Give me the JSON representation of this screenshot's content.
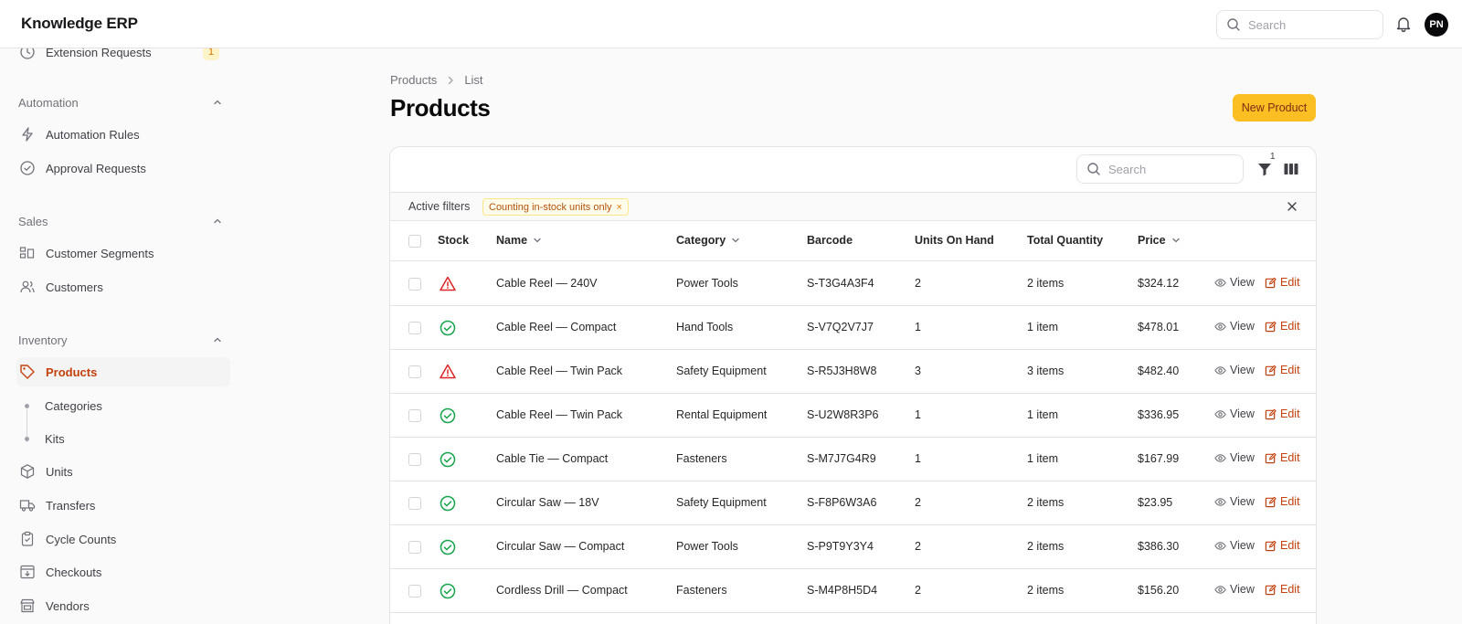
{
  "app": {
    "title": "Knowledge ERP",
    "user_initials": "PN"
  },
  "topbar": {
    "search_placeholder": "Search"
  },
  "sidebar": {
    "extension_requests": {
      "label": "Extension Requests",
      "badge": "1"
    },
    "groups": {
      "automation": {
        "label": "Automation",
        "items": [
          "Automation Rules",
          "Approval Requests"
        ]
      },
      "sales": {
        "label": "Sales",
        "items": [
          "Customer Segments",
          "Customers"
        ]
      },
      "inventory": {
        "label": "Inventory",
        "items": [
          "Products",
          "Categories",
          "Kits",
          "Units",
          "Transfers",
          "Cycle Counts",
          "Checkouts",
          "Vendors"
        ]
      }
    },
    "active_item": "Products"
  },
  "breadcrumb": [
    "Products",
    "List"
  ],
  "page": {
    "title": "Products",
    "new_button": "New Product"
  },
  "table_toolbar": {
    "search_placeholder": "Search",
    "filter_count": "1"
  },
  "filters": {
    "label": "Active filters",
    "chips": [
      "Counting in-stock units only"
    ]
  },
  "table": {
    "columns": [
      "Stock",
      "Name",
      "Category",
      "Barcode",
      "Units On Hand",
      "Total Quantity",
      "Price"
    ],
    "view_label": "View",
    "edit_label": "Edit",
    "rows": [
      {
        "stock": "warning",
        "name": "Cable Reel — 240V",
        "category": "Power Tools",
        "barcode": "S-T3G4A3F4",
        "units": "2",
        "total": "2 items",
        "price": "$324.12"
      },
      {
        "stock": "ok",
        "name": "Cable Reel — Compact",
        "category": "Hand Tools",
        "barcode": "S-V7Q2V7J7",
        "units": "1",
        "total": "1 item",
        "price": "$478.01"
      },
      {
        "stock": "warning",
        "name": "Cable Reel — Twin Pack",
        "category": "Safety Equipment",
        "barcode": "S-R5J3H8W8",
        "units": "3",
        "total": "3 items",
        "price": "$482.40"
      },
      {
        "stock": "ok",
        "name": "Cable Reel — Twin Pack",
        "category": "Rental Equipment",
        "barcode": "S-U2W8R3P6",
        "units": "1",
        "total": "1 item",
        "price": "$336.95"
      },
      {
        "stock": "ok",
        "name": "Cable Tie — Compact",
        "category": "Fasteners",
        "barcode": "S-M7J7G4R9",
        "units": "1",
        "total": "1 item",
        "price": "$167.99"
      },
      {
        "stock": "ok",
        "name": "Circular Saw — 18V",
        "category": "Safety Equipment",
        "barcode": "S-F8P6W3A6",
        "units": "2",
        "total": "2 items",
        "price": "$23.95"
      },
      {
        "stock": "ok",
        "name": "Circular Saw — Compact",
        "category": "Power Tools",
        "barcode": "S-P9T9Y3Y4",
        "units": "2",
        "total": "2 items",
        "price": "$386.30"
      },
      {
        "stock": "ok",
        "name": "Cordless Drill — Compact",
        "category": "Fasteners",
        "barcode": "S-M4P8H5D4",
        "units": "2",
        "total": "2 items",
        "price": "$156.20"
      }
    ]
  },
  "colors": {
    "accent": "#fbbf24",
    "active_text": "#c2410c",
    "ok": "#16a34a",
    "warning": "#dc2626"
  }
}
